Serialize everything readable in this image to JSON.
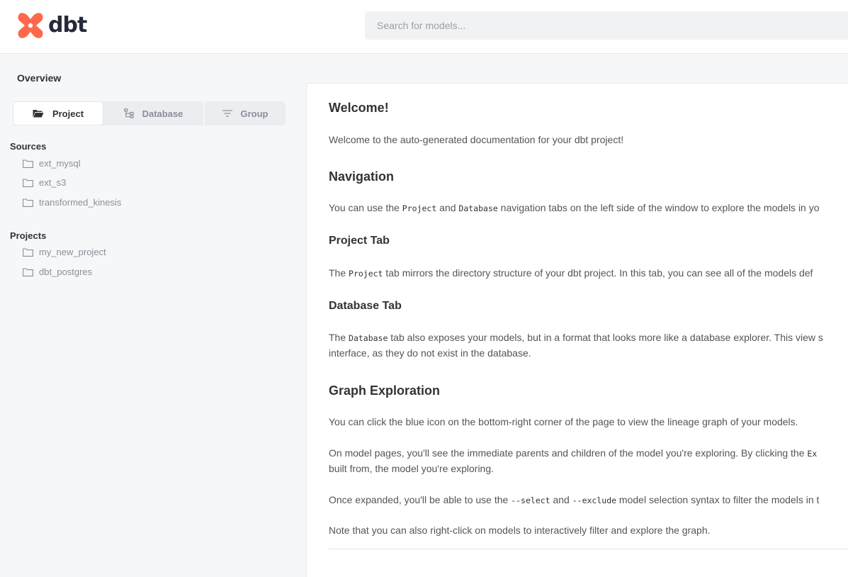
{
  "header": {
    "logo_text": "dbt",
    "search_placeholder": "Search for models..."
  },
  "sidebar": {
    "overview_label": "Overview",
    "tabs": [
      {
        "label": "Project",
        "icon": "folder-open-icon",
        "active": true
      },
      {
        "label": "Database",
        "icon": "hierarchy-icon",
        "active": false
      },
      {
        "label": "Group",
        "icon": "filter-lines-icon",
        "active": false
      }
    ],
    "sources_title": "Sources",
    "sources": [
      "ext_mysql",
      "ext_s3",
      "transformed_kinesis"
    ],
    "projects_title": "Projects",
    "projects": [
      "my_new_project",
      "dbt_postgres"
    ]
  },
  "main": {
    "welcome_title": "Welcome!",
    "welcome_text": "Welcome to the auto-generated documentation for your dbt project!",
    "navigation_title": "Navigation",
    "navigation_text_1": "You can use the ",
    "navigation_code_1": "Project",
    "navigation_text_2": " and ",
    "navigation_code_2": "Database",
    "navigation_text_3": " navigation tabs on the left side of the window to explore the models in yo",
    "project_tab_title": "Project Tab",
    "project_tab_text_1": "The ",
    "project_tab_code": "Project",
    "project_tab_text_2": " tab mirrors the directory structure of your dbt project. In this tab, you can see all of the models def",
    "database_tab_title": "Database Tab",
    "database_tab_text_1": "The ",
    "database_tab_code": "Database",
    "database_tab_text_2": " tab also exposes your models, but in a format that looks more like a database explorer. This view s",
    "database_tab_text_3": "interface, as they do not exist in the database.",
    "graph_title": "Graph Exploration",
    "graph_text_1": "You can click the blue icon on the bottom-right corner of the page to view the lineage graph of your models.",
    "graph_text_2a": "On model pages, you'll see the immediate parents and children of the model you're exploring. By clicking the ",
    "graph_text_2_code": "Ex",
    "graph_text_2b": "built from, the model you're exploring.",
    "graph_text_3a": "Once expanded, you'll be able to use the ",
    "graph_text_3_code1": "--select",
    "graph_text_3b": " and ",
    "graph_text_3_code2": "--exclude",
    "graph_text_3c": " model selection syntax to filter the models in t",
    "graph_text_4": "Note that you can also right-click on models to interactively filter and explore the graph."
  },
  "colors": {
    "brand_orange": "#ff694b",
    "sidebar_bg": "#f6f7f9",
    "text_muted": "#8a8f98"
  }
}
